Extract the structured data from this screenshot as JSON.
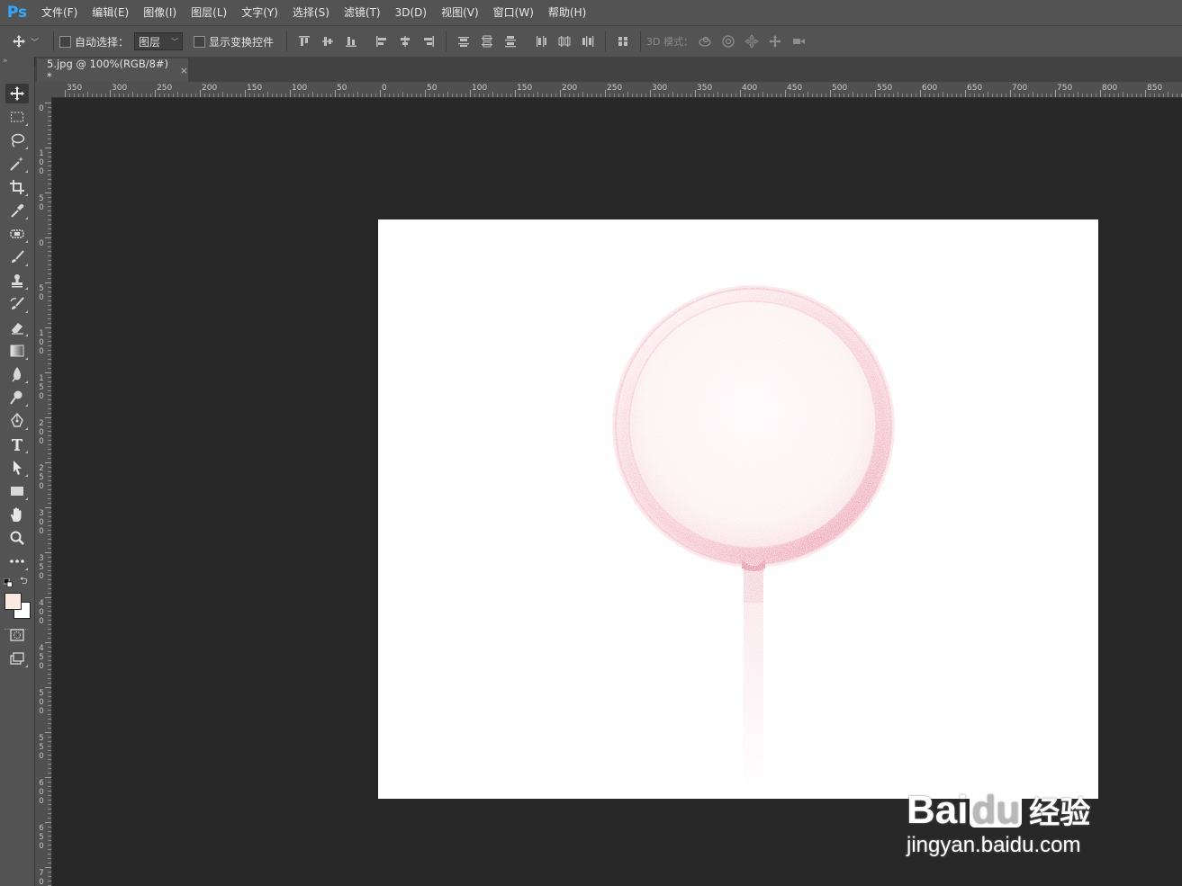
{
  "app": {
    "logo": "Ps"
  },
  "menu": [
    "文件(F)",
    "编辑(E)",
    "图像(I)",
    "图层(L)",
    "文字(Y)",
    "选择(S)",
    "滤镜(T)",
    "3D(D)",
    "视图(V)",
    "窗口(W)",
    "帮助(H)"
  ],
  "options": {
    "auto_select_label": "自动选择：",
    "auto_select_target": "图层",
    "show_transform_label": "显示变换控件",
    "mode_3d_label": "3D 模式："
  },
  "document": {
    "tab_title": "5.jpg @ 100%(RGB/8#) *",
    "close_glyph": "×"
  },
  "rulers": {
    "horizontal_labels": [
      "350",
      "300",
      "250",
      "200",
      "150",
      "100",
      "50",
      "0",
      "50",
      "100",
      "150",
      "200",
      "250",
      "300",
      "350",
      "400",
      "450",
      "500",
      "550",
      "600",
      "650",
      "700",
      "750",
      "800",
      "850"
    ],
    "vertical_labels": [
      "0",
      "100",
      "50",
      "0",
      "50",
      "100",
      "150",
      "200",
      "250",
      "300",
      "350",
      "400",
      "450",
      "500",
      "550",
      "600",
      "650",
      "700"
    ]
  },
  "colors": {
    "foreground": "#fbe9e1",
    "background": "#ffffff",
    "lollipop_rim": "#e3667f",
    "lollipop_face": "#fbeef1"
  },
  "tools": [
    "move-icon",
    "marquee-icon",
    "lasso-icon",
    "magic-wand-icon",
    "crop-icon",
    "eyedropper-icon",
    "healing-brush-icon",
    "brush-icon",
    "clone-stamp-icon",
    "history-brush-icon",
    "eraser-icon",
    "gradient-icon",
    "blur-icon",
    "dodge-icon",
    "pen-icon",
    "type-icon",
    "path-selection-icon",
    "rectangle-icon",
    "hand-icon",
    "zoom-icon",
    "more-icon"
  ],
  "watermark": {
    "brand": "Bai",
    "brand_suffix": "du",
    "cn": "经验",
    "url": "jingyan.baidu.com"
  }
}
